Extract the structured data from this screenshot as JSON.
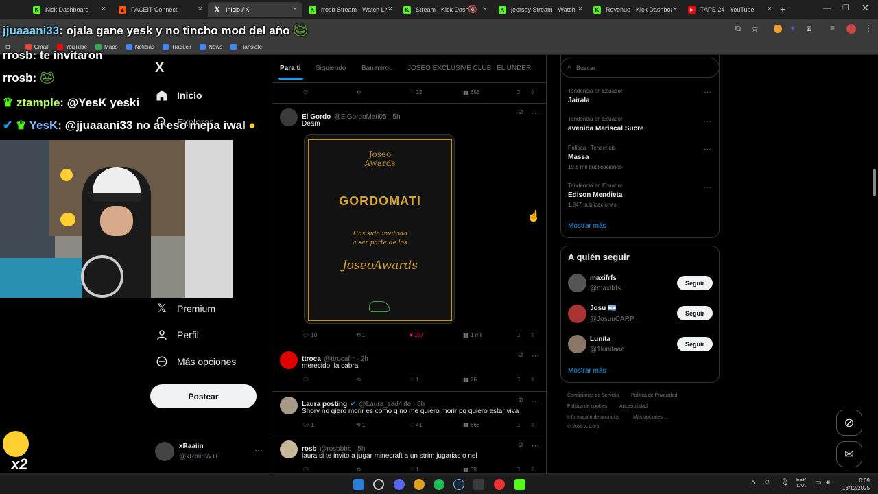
{
  "browser": {
    "tabs": [
      {
        "label": "Kick Dashboard",
        "color": "#53fc18"
      },
      {
        "label": "FACEIT Connect",
        "color": "#ff5500"
      },
      {
        "label": "Inicio / X",
        "color": "#ffffff"
      },
      {
        "label": "rrosb Stream - Watch Live",
        "color": "#53fc18"
      },
      {
        "label": "Stream - Kick Dashboard",
        "color": "#53fc18"
      },
      {
        "label": "jeersay Stream - Watch Live",
        "color": "#53fc18"
      },
      {
        "label": "Revenue - Kick Dashboard",
        "color": "#53fc18"
      },
      {
        "label": "TAPE 24 - YouTube",
        "color": "#ff0000"
      }
    ],
    "new_tab": "+",
    "bookmarks": [
      "Gmail",
      "YouTube",
      "Maps",
      "Noticias",
      "Traducir",
      "News",
      "Translate"
    ]
  },
  "overlay": {
    "chat": [
      {
        "user": "jjuaaani33",
        "msg": ": ojala gane yesk y no tincho mod del año",
        "color": "#7fd4ff"
      },
      {
        "user": "rrosb",
        "msg": ": te invitaron",
        "color": "#ffffff"
      },
      {
        "user": "rrosb",
        "msg": ":",
        "color": "#ffffff"
      },
      {
        "user": "ztample",
        "msg": ": @YesK yeski",
        "color": "#b6ff6b"
      },
      {
        "user": "YesK",
        "msg": ": @jjuaaani33 no ai eso mepa iwal",
        "color": "#7fb8ff"
      }
    ],
    "badge": "x2"
  },
  "nav": {
    "logo": "X",
    "items": [
      "Inicio",
      "Explorar",
      "Premium",
      "Perfil",
      "Más opciones"
    ],
    "post_label": "Postear",
    "account_name": "xRaaiin",
    "account_handle": "@xRaiinWTF"
  },
  "timeline": {
    "tabs": [
      "Para ti",
      "Siguiendo",
      "Bananirou",
      "JOSEO EXCLUSIVE CLUB",
      "EL UNDER."
    ],
    "top_actions": {
      "reply": "",
      "retweet": "",
      "like": "32",
      "views": "656"
    },
    "tweets": [
      {
        "name": "El Gordo",
        "handle": "@ElGordoMati05 · 5h",
        "text": "Deam",
        "card": {
          "logo_1": "Joseo",
          "logo_2": "Awards",
          "title": "GORDOMATI",
          "line1": "Has sido invitado",
          "line2": "a ser parte de los",
          "script": "JoseoAwards"
        },
        "replies": "10",
        "retweets": "1",
        "likes": "107",
        "views": "1 mil"
      },
      {
        "name": "ttroca",
        "handle": "@ttrocafrr · 2h",
        "text": "merecido, la cabra",
        "replies": "",
        "retweets": "",
        "likes": "1",
        "views": "26"
      },
      {
        "name": "Laura posting",
        "handle": "@Laura_sad4life · 5h",
        "text": "Shory no qiero morir es como q no me quiero morir pq quiero estar viva",
        "replies": "1",
        "retweets": "1",
        "likes": "41",
        "views": "666"
      },
      {
        "name": "rosb",
        "handle": "@rosbbbb · 5h",
        "text": "laura si te invito a jugar minecraft a un strim jugarias o nel",
        "replies": "",
        "retweets": "",
        "likes": "1",
        "views": "39"
      }
    ]
  },
  "sidebar": {
    "search_placeholder": "Buscar",
    "trends": [
      {
        "context": "Tendencia en Ecuador",
        "name": "Jairala",
        "count": ""
      },
      {
        "context": "Tendencia en Ecuador",
        "name": "avenida Mariscal Sucre",
        "count": ""
      },
      {
        "context": "Política · Tendencia",
        "name": "Massa",
        "count": "19,6 mil publicaciones"
      },
      {
        "context": "Tendencia en Ecuador",
        "name": "Edison Mendieta",
        "count": "1.847 publicaciones"
      }
    ],
    "show_more": "Mostrar más",
    "who_to_follow_title": "A quién seguir",
    "follow": [
      {
        "name": "maxifrfs",
        "handle": "@maxifrfs"
      },
      {
        "name": "Josu 🇦🇷",
        "handle": "@JosuuCARP_"
      },
      {
        "name": "Lunita",
        "handle": "@1lunitaaa"
      }
    ],
    "follow_label": "Seguir",
    "show_more_2": "Mostrar más",
    "footer": [
      "Condiciones de Servicio",
      "Política de Privacidad",
      "Política de cookies",
      "Accesibilidad",
      "Información de anuncios",
      "Más opciones ...",
      "© 2025 X Corp."
    ]
  },
  "taskbar": {
    "lang1": "ESP",
    "lang2": "LAA",
    "time": "0:09",
    "date": "13/12/2025"
  }
}
